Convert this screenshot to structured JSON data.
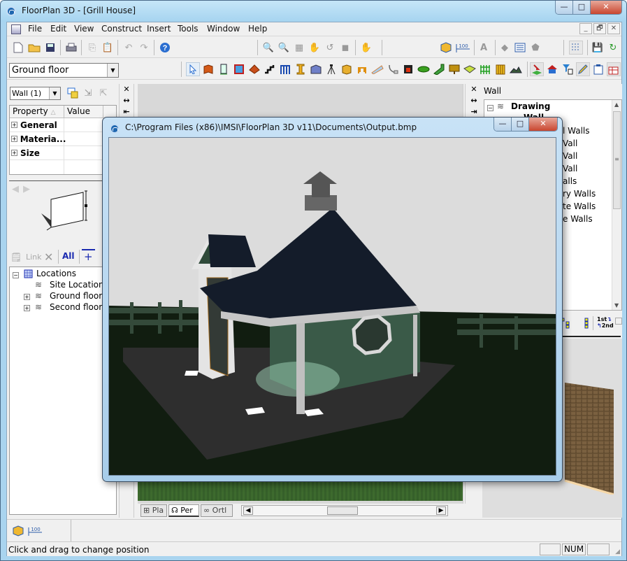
{
  "window": {
    "title": "FloorPlan 3D - [Grill House]",
    "minimize": "—",
    "maximize": "□",
    "close": "✕"
  },
  "menu": [
    "File",
    "Edit",
    "View",
    "Construct",
    "Insert",
    "Tools",
    "Window",
    "Help"
  ],
  "mdi_controls": [
    "_",
    "🗗",
    "✕"
  ],
  "toolbar_standard": [
    "new-document",
    "open-folder",
    "save",
    "print",
    "copy",
    "paste",
    "undo",
    "redo",
    "help"
  ],
  "toolbar_view": [
    "zoom-in",
    "zoom-out",
    "zoom-window",
    "pan-hand",
    "zoom-previous",
    "zoom-extents",
    "orbit-hand"
  ],
  "toolbar_right": [
    "3d-view",
    "dimension-100",
    "text-style",
    "measure-tool",
    "properties-list",
    "material-fill",
    "grid-toggle",
    "save-view",
    "restore-view"
  ],
  "dimension_label": "100",
  "floor_selector": {
    "value": "Ground floor"
  },
  "construct_tools": [
    "select-arrow",
    "wall",
    "door",
    "window",
    "roof",
    "stairs",
    "railing",
    "column",
    "room",
    "survey-tripod",
    "cabinet",
    "furniture",
    "roof-skylight",
    "plumbing",
    "fireplace",
    "landscape-shrub",
    "ramp",
    "sign",
    "deck",
    "fence",
    "gate",
    "terrain"
  ],
  "construct_tools_right": [
    "import",
    "house",
    "filter",
    "pencil-edit",
    "clipboard",
    "table-edit"
  ],
  "properties_panel": {
    "object_selector": "Wall (1)",
    "headers": {
      "property": "Property",
      "sort": "△",
      "value": "Value"
    },
    "rows": [
      {
        "label": "General"
      },
      {
        "label": "Materia..."
      },
      {
        "label": "Size"
      }
    ]
  },
  "pin_strip": [
    "✕",
    "↔",
    "⇤"
  ],
  "locations_toolbar": {
    "link": "Link",
    "delete": "✕",
    "all": "All",
    "add": "+"
  },
  "locations_tree": {
    "root": "Locations",
    "items": [
      "Site Location",
      "Ground floor",
      "Second floor"
    ]
  },
  "right_panel": {
    "header": "Wall",
    "tree_root": "Drawing",
    "tree_child": "Wall",
    "visible_items": [
      "l Walls",
      "Vall",
      "Vall",
      "Vall",
      "alls",
      "ry Walls",
      "te Walls",
      "e Walls"
    ],
    "tool_labels": {
      "order_top": "1st",
      "order_bottom": "2nd"
    }
  },
  "view_tabs": [
    {
      "label": "Pla",
      "icon": "plan-icon"
    },
    {
      "label": "Per",
      "icon": "perspective-icon",
      "active": true
    },
    {
      "label": "Ortl",
      "icon": "orthographic-icon"
    }
  ],
  "image_viewer": {
    "title": "C:\\Program Files (x86)\\IMSI\\FloorPlan 3D v11\\Documents\\Output.bmp",
    "content": "Rendered 3D image of a grill house with dark hip roof, chimney, octagonal window, green siding, fence and paved patio"
  },
  "bottom_icons": [
    "3d-view",
    "dimension-100"
  ],
  "statusbar": {
    "message": "Click and drag to change position",
    "indicators": [
      "",
      "NUM",
      ""
    ]
  }
}
